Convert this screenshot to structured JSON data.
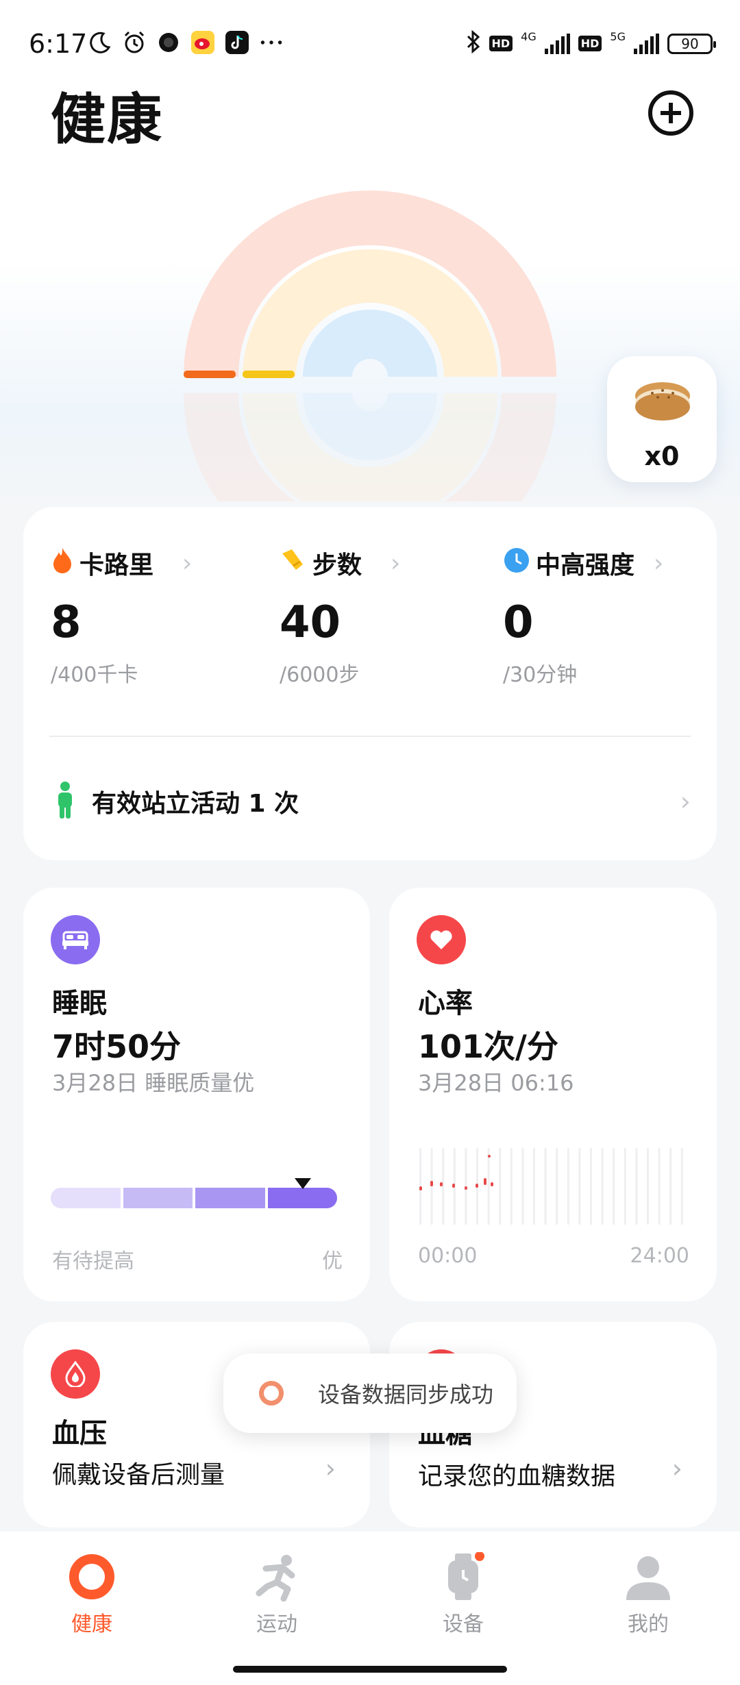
{
  "status_bar": {
    "time": "6:17",
    "hd1": "HD",
    "net1": "4G",
    "hd2": "HD",
    "net2": "5G",
    "battery": "90"
  },
  "header": {
    "title": "健康"
  },
  "reward": {
    "count": "x0"
  },
  "activity": {
    "metrics": [
      {
        "label": "卡路里",
        "value": "8",
        "goal": "/400千卡",
        "icon": "flame-icon",
        "color": "#ff6a1a"
      },
      {
        "label": "步数",
        "value": "40",
        "goal": "/6000步",
        "icon": "shoe-icon",
        "color": "#ffc21a"
      },
      {
        "label": "中高强度",
        "value": "0",
        "goal": "/30分钟",
        "icon": "clock-icon",
        "color": "#3aa0f0"
      }
    ],
    "stand_text": "有效站立活动 1 次"
  },
  "sleep": {
    "title": "睡眠",
    "value": "7时50分",
    "sub": "3月28日 睡眠质量优",
    "axis_left": "有待提高",
    "axis_right": "优"
  },
  "heart": {
    "title": "心率",
    "value": "101次/分",
    "sub": "3月28日 06:16",
    "axis_left": "00:00",
    "axis_right": "24:00"
  },
  "blood_pressure": {
    "title": "血压",
    "desc": "佩戴设备后测量"
  },
  "blood_sugar": {
    "title": "血糖",
    "desc": "记录您的血糖数据"
  },
  "toast": {
    "text": "设备数据同步成功"
  },
  "nav": {
    "items": [
      {
        "label": "健康"
      },
      {
        "label": "运动"
      },
      {
        "label": "设备"
      },
      {
        "label": "我的"
      }
    ]
  },
  "colors": {
    "accent": "#ff5a2c",
    "sleep_purple": "#8a6cf0",
    "heart_red": "#f5474a"
  }
}
